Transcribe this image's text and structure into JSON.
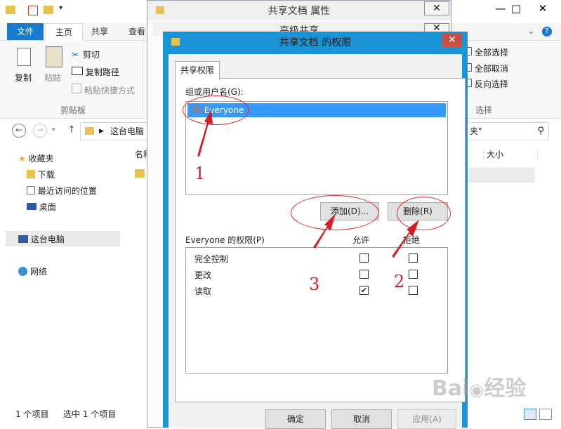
{
  "explorer": {
    "tabs": {
      "file": "文件",
      "home": "主页",
      "share": "共享",
      "view": "查看"
    },
    "ribbon": {
      "copy": "复制",
      "paste": "粘贴",
      "cut": "剪切",
      "copy_path": "复制路径",
      "paste_shortcut": "粘贴快捷方式",
      "clipboard_group": "剪贴板",
      "select_all": "全部选择",
      "select_none": "全部取消",
      "invert_select": "反向选择",
      "select_group": "选择"
    },
    "address": {
      "location": "这台电脑",
      "search_tail": "夹\""
    },
    "columns": {
      "name": "名称",
      "size": "大小"
    },
    "nav": {
      "favorites": "收藏夹",
      "downloads": "下载",
      "recent": "最近访问的位置",
      "desktop": "桌面",
      "this_pc": "这台电脑",
      "network": "网络"
    },
    "status": {
      "items": "1 个项目",
      "selected": "选中 1 个项目"
    }
  },
  "props_dialog": {
    "title": "共享文档 属性",
    "sub_title": "高级共享"
  },
  "perm_dialog": {
    "title": "共享文档 的权限",
    "tab": "共享权限",
    "group_label": "组或用户名(G):",
    "users": [
      "Everyone"
    ],
    "add_button": "添加(D)...",
    "remove_button": "删除(R)",
    "perm_label": "Everyone 的权限(P)",
    "allow_header": "允许",
    "deny_header": "拒绝",
    "permissions": [
      {
        "name": "完全控制",
        "allow": false,
        "deny": false
      },
      {
        "name": "更改",
        "allow": false,
        "deny": false
      },
      {
        "name": "读取",
        "allow": true,
        "deny": false
      }
    ],
    "ok_button": "确定",
    "cancel_button": "取消",
    "apply_button": "应用(A)"
  },
  "annotations": {
    "n1": "1",
    "n2": "2",
    "n3": "3"
  },
  "accent": "#1b94d6"
}
